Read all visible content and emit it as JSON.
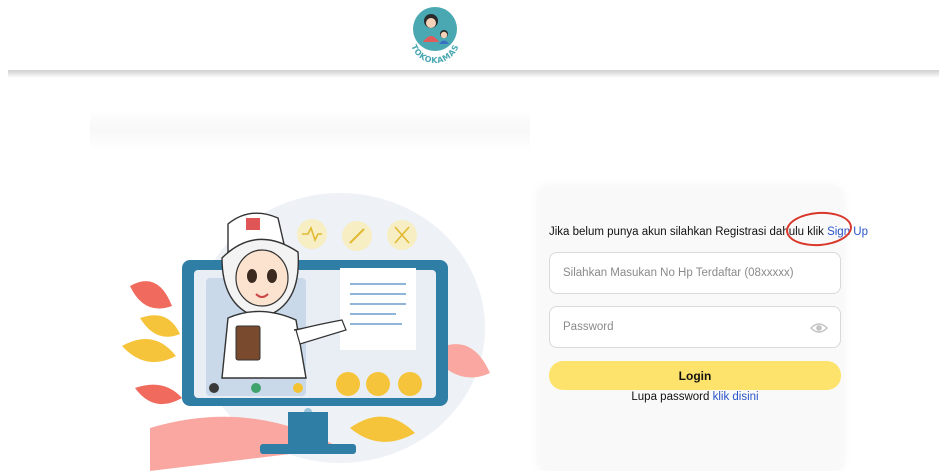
{
  "brand": {
    "name": "TOKOKAMAS"
  },
  "register": {
    "text": "Jika belum punya akun silahkan Registrasi dahulu klik",
    "link_label": "Sign Up"
  },
  "phone_input": {
    "placeholder": "Silahkan Masukan No Hp Terdaftar (08xxxxx)"
  },
  "password_input": {
    "placeholder": "Password"
  },
  "login_button": {
    "label": "Login"
  },
  "forgot": {
    "text": "Lupa password",
    "link_label": "klik disini"
  },
  "colors": {
    "accent_yellow": "#fde36b",
    "link_blue": "#2a55c8",
    "annotation_red": "#d8372a",
    "brand_teal": "#4aa8b3"
  },
  "icons": [
    "eye-icon",
    "doctor-illustration",
    "monitor-illustration"
  ]
}
